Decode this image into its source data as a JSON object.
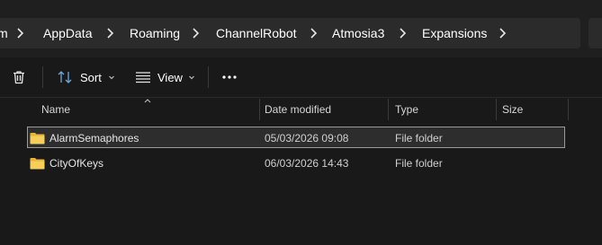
{
  "breadcrumb": {
    "items": [
      "m",
      "AppData",
      "Roaming",
      "ChannelRobot",
      "Atmosia3",
      "Expansions"
    ]
  },
  "toolbar": {
    "sort_label": "Sort",
    "view_label": "View",
    "more_label": "..."
  },
  "columns": {
    "name": "Name",
    "date_modified": "Date modified",
    "type": "Type",
    "size": "Size"
  },
  "files": [
    {
      "name": "AlarmSemaphores",
      "date": "05/03/2026 09:08",
      "type": "File folder",
      "size": ""
    },
    {
      "name": "CityOfKeys",
      "date": "06/03/2026 14:43",
      "type": "File folder",
      "size": ""
    }
  ],
  "colors": {
    "folder": "#f2c94c",
    "background": "#191919",
    "selection_border": "#9a9a9a"
  }
}
